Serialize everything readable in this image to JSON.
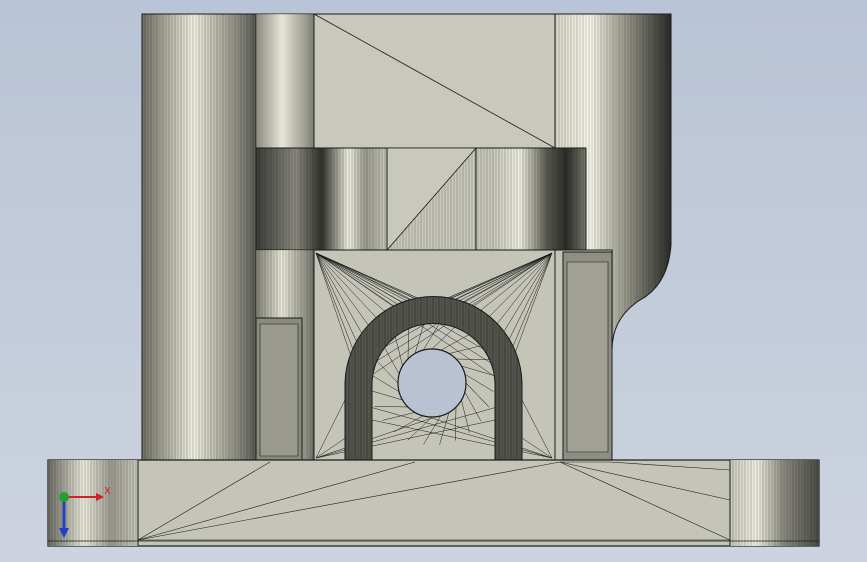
{
  "viewport": {
    "background_top": "#b9c4d6",
    "background_bottom": "#cdd4df",
    "part_color": "#c8c8bc",
    "edge_color": "#1a1a1a"
  },
  "triad": {
    "x_label": "X",
    "x_color": "#d0202a",
    "y_color": "#20a030",
    "z_color": "#2040c0",
    "icon": "axis-triad-icon"
  }
}
